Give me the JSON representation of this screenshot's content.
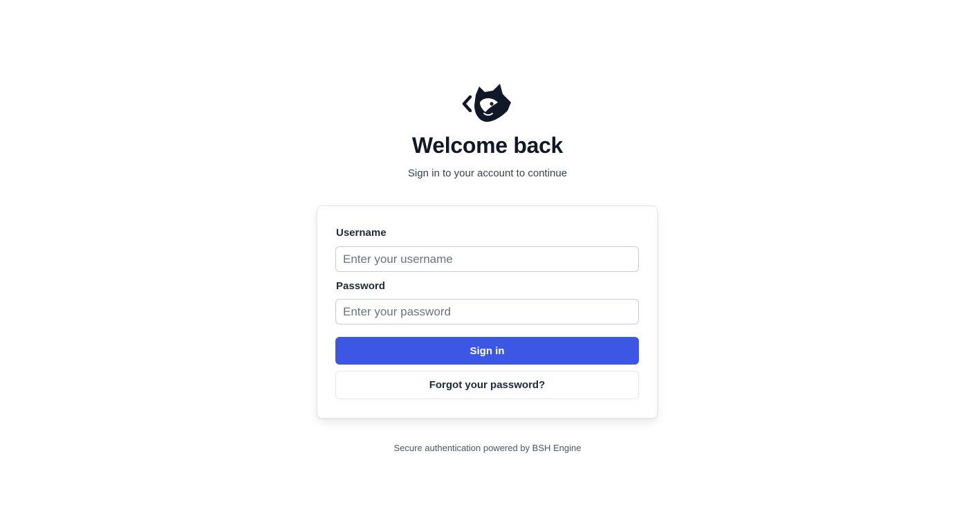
{
  "brand": {
    "logo_icon": "raccoon-code-logo",
    "logo_color": "#111827"
  },
  "header": {
    "title": "Welcome back",
    "subtitle": "Sign in to your account to continue"
  },
  "form": {
    "username_label": "Username",
    "username_value": "",
    "username_placeholder": "Enter your username",
    "password_label": "Password",
    "password_value": "",
    "password_placeholder": "Enter your password",
    "signin_label": "Sign in",
    "forgot_label": "Forgot your password?"
  },
  "footer": {
    "text": "Secure authentication powered by BSH Engine"
  },
  "colors": {
    "primary": "#3b57e4",
    "text": "#111827",
    "muted": "#374151",
    "border": "#e5e7eb"
  }
}
